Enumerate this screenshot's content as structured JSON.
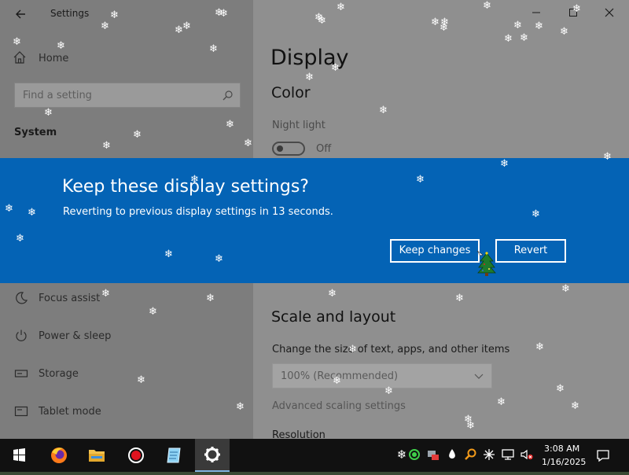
{
  "window": {
    "title": "Settings",
    "sidebar": {
      "home_label": "Home",
      "search_placeholder": "Find a setting",
      "section_header": "System",
      "items": [
        {
          "label": "Focus assist",
          "icon": "moon-icon"
        },
        {
          "label": "Power & sleep",
          "icon": "power-icon"
        },
        {
          "label": "Storage",
          "icon": "storage-icon"
        },
        {
          "label": "Tablet mode",
          "icon": "tablet-icon"
        }
      ]
    },
    "main": {
      "title": "Display",
      "color_header": "Color",
      "night_light_label": "Night light",
      "night_light_state": "Off",
      "scale_header": "Scale and layout",
      "size_label": "Change the size of text, apps, and other items",
      "scale_value": "100% (Recommended)",
      "advanced_link": "Advanced scaling settings",
      "resolution_label": "Resolution"
    }
  },
  "dialog": {
    "title": "Keep these display settings?",
    "message": "Reverting to previous display settings in 13 seconds.",
    "keep_label": "Keep changes",
    "revert_label": "Revert"
  },
  "taskbar": {
    "apps": [
      "start-icon",
      "firefox-icon",
      "file-explorer-icon",
      "record-icon",
      "notepad-icon",
      "settings-icon"
    ],
    "active_app": "settings-icon",
    "time": "3:08 AM",
    "date": "1/16/2025"
  },
  "colors": {
    "dialog_blue": "#0463b5",
    "overlay_gray": "#8f8f8f",
    "taskbar": "#111111"
  }
}
